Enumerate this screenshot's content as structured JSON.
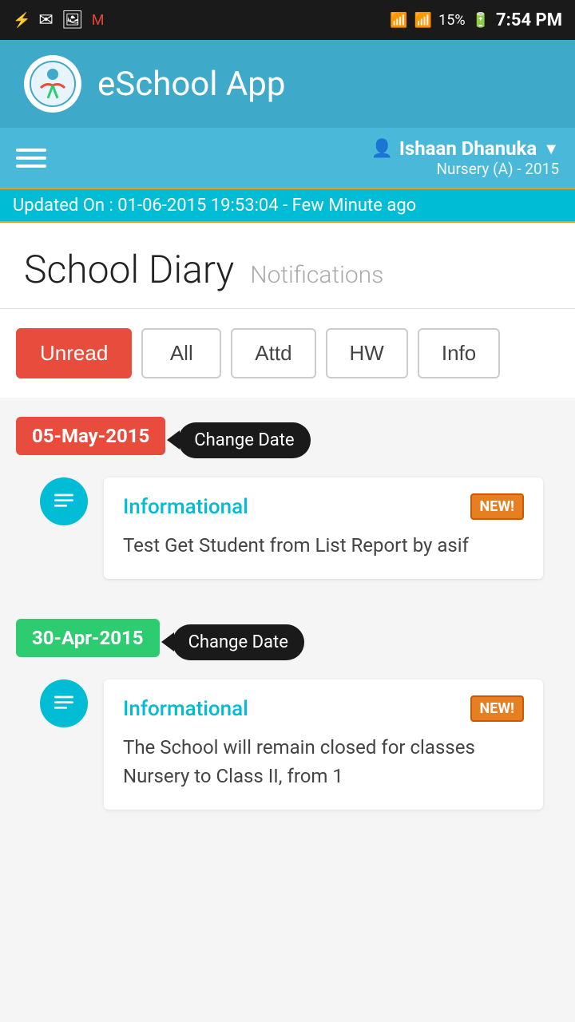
{
  "statusBar": {
    "time": "7:54 PM",
    "battery": "15%",
    "icons": [
      "usb",
      "mail",
      "image",
      "gmail",
      "wifi",
      "signal",
      "battery"
    ]
  },
  "header": {
    "appName": "eSchool App",
    "logoSymbol": "🎓"
  },
  "nav": {
    "userName": "Ishaan Dhanuka",
    "userClass": "Nursery (A) - 2015"
  },
  "updateBanner": {
    "labelBold": "Updated On :",
    "value": " 01-06-2015 19:53:04 - Few Minute ago"
  },
  "pageTitleArea": {
    "title": "School Diary",
    "subtitle": "Notifications"
  },
  "filterTabs": [
    {
      "id": "unread",
      "label": "Unread",
      "active": true
    },
    {
      "id": "all",
      "label": "All",
      "active": false
    },
    {
      "id": "attd",
      "label": "Attd",
      "active": false
    },
    {
      "id": "hw",
      "label": "HW",
      "active": false
    },
    {
      "id": "info",
      "label": "Info",
      "active": false
    }
  ],
  "diaryEntries": [
    {
      "date": "05-May-2015",
      "dateColor": "red",
      "changeDateLabel": "Change Date",
      "items": [
        {
          "type": "Informational",
          "isNew": true,
          "newLabel": "NEW!",
          "body": "Test Get Student from List Report by asif"
        }
      ]
    },
    {
      "date": "30-Apr-2015",
      "dateColor": "green",
      "changeDateLabel": "Change Date",
      "items": [
        {
          "type": "Informational",
          "isNew": true,
          "newLabel": "NEW!",
          "body": "The School will remain closed for classes Nursery to Class II, from 1"
        }
      ]
    }
  ]
}
